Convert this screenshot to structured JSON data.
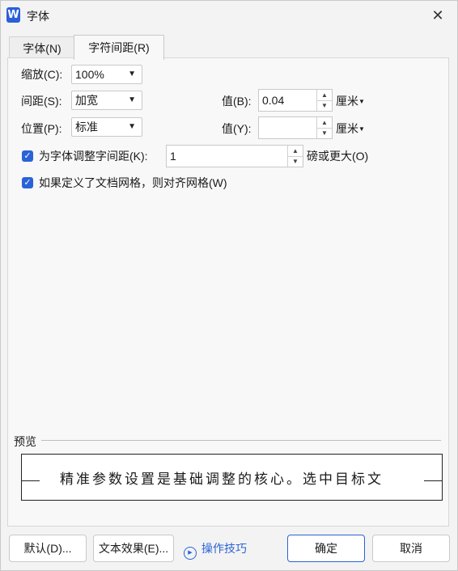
{
  "window": {
    "title": "字体",
    "app_icon_letter": "W",
    "close_glyph": "✕"
  },
  "tabs": [
    {
      "label": "字体(N)",
      "active": false
    },
    {
      "label": "字符间距(R)",
      "active": true
    }
  ],
  "form": {
    "scale": {
      "label": "缩放(C):",
      "value": "100%"
    },
    "spacing": {
      "label": "间距(S):",
      "value": "加宽",
      "value_label": "值(B):",
      "amount": "0.04",
      "unit": "厘米"
    },
    "position": {
      "label": "位置(P):",
      "value": "标准",
      "value_label": "值(Y):",
      "amount": "",
      "unit": "厘米"
    },
    "kerning": {
      "label": "为字体调整字间距(K):",
      "checked": true,
      "points": "1",
      "suffix": "磅或更大(O)"
    },
    "snap_grid": {
      "label": "如果定义了文档网格，则对齐网格(W)",
      "checked": true
    }
  },
  "preview": {
    "label": "预览",
    "text": "精准参数设置是基础调整的核心。选中目标文"
  },
  "buttons": {
    "default": "默认(D)...",
    "text_effects": "文本效果(E)...",
    "tips": "操作技巧",
    "ok": "确定",
    "cancel": "取消"
  },
  "colors": {
    "accent": "#2b63d6",
    "background": "#f3f3f3"
  }
}
